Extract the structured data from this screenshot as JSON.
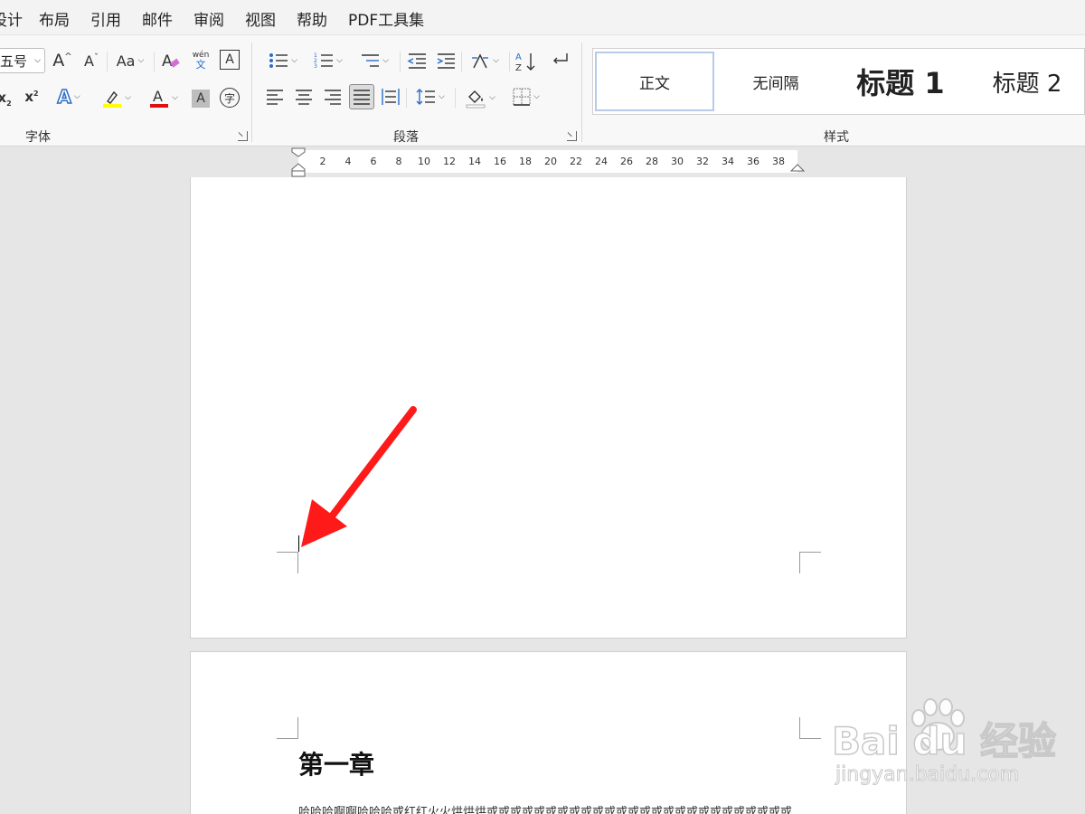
{
  "menu": {
    "items": [
      "设计",
      "布局",
      "引用",
      "邮件",
      "审阅",
      "视图",
      "帮助",
      "PDF工具集"
    ]
  },
  "ribbon": {
    "font_group": {
      "label": "字体",
      "font_size_value": "五号",
      "change_case_label": "Aa",
      "phonetic_top": "wén",
      "phonetic_bottom": "文",
      "enclose_char": "字",
      "highlight_color": "#ffff00",
      "font_color": "#e01010"
    },
    "paragraph_group": {
      "label": "段落"
    },
    "styles_group": {
      "label": "样式",
      "styles": [
        "正文",
        "无间隔",
        "标题 1",
        "标题 2"
      ],
      "selected": "正文"
    }
  },
  "ruler": {
    "ticks": [
      "2",
      "4",
      "6",
      "8",
      "10",
      "12",
      "14",
      "16",
      "18",
      "20",
      "22",
      "24",
      "26",
      "28",
      "30",
      "32",
      "34",
      "36",
      "38"
    ]
  },
  "document": {
    "chapter_title": "第一章",
    "body_line": "哈哈哈啊啊哈哈哈或红红火火烘烘烘或或或或或或或或或或或或或或或或或或或或或或或或或或"
  },
  "annotation": {
    "arrow_color": "#ff1a1a"
  },
  "watermark": {
    "brand": "Bai du 经验",
    "url": "jingyan.baidu.com"
  }
}
